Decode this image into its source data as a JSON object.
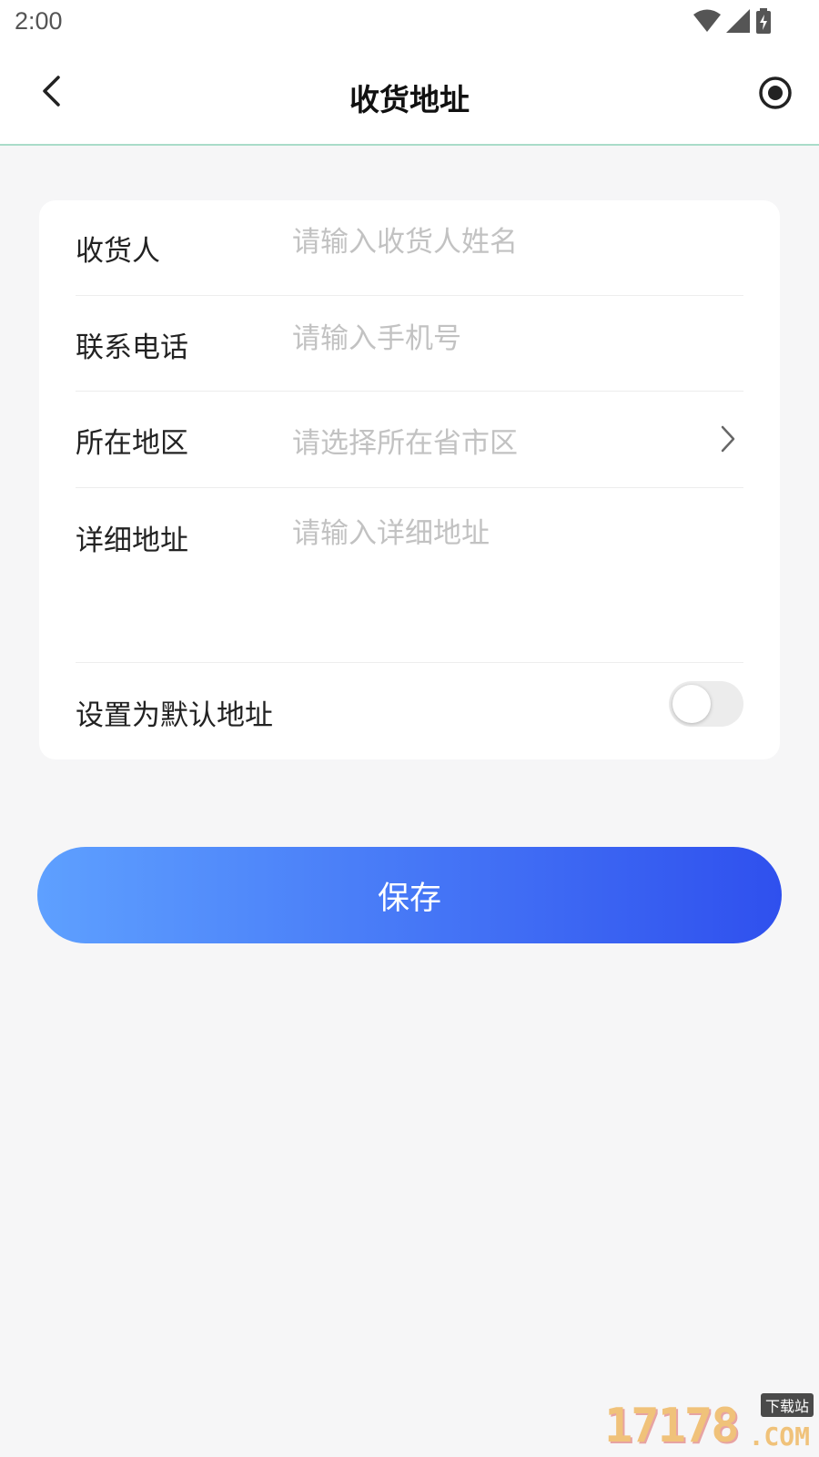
{
  "status_bar": {
    "time": "2:00",
    "icons": [
      "wifi-icon",
      "cell-signal-icon",
      "battery-charging-icon"
    ]
  },
  "app_bar": {
    "title": "收货地址",
    "back_icon": "chevron-left-icon",
    "action_icon": "record-icon"
  },
  "form": {
    "receiver": {
      "label": "收货人",
      "placeholder": "请输入收货人姓名"
    },
    "phone": {
      "label": "联系电话",
      "placeholder": "请输入手机号"
    },
    "region": {
      "label": "所在地区",
      "placeholder": "请选择所在省市区"
    },
    "detail": {
      "label": "详细地址",
      "placeholder": "请输入详细地址"
    },
    "default": {
      "label": "设置为默认地址",
      "enabled": false
    }
  },
  "save_button": {
    "label": "保存"
  },
  "watermark": {
    "main": "17178",
    "suffix": ".COM",
    "tag": "下载站"
  },
  "colors": {
    "accent_start": "#5ea0ff",
    "accent_end": "#2f50ee",
    "background": "#f6f6f7",
    "placeholder": "#c2c2c2"
  }
}
